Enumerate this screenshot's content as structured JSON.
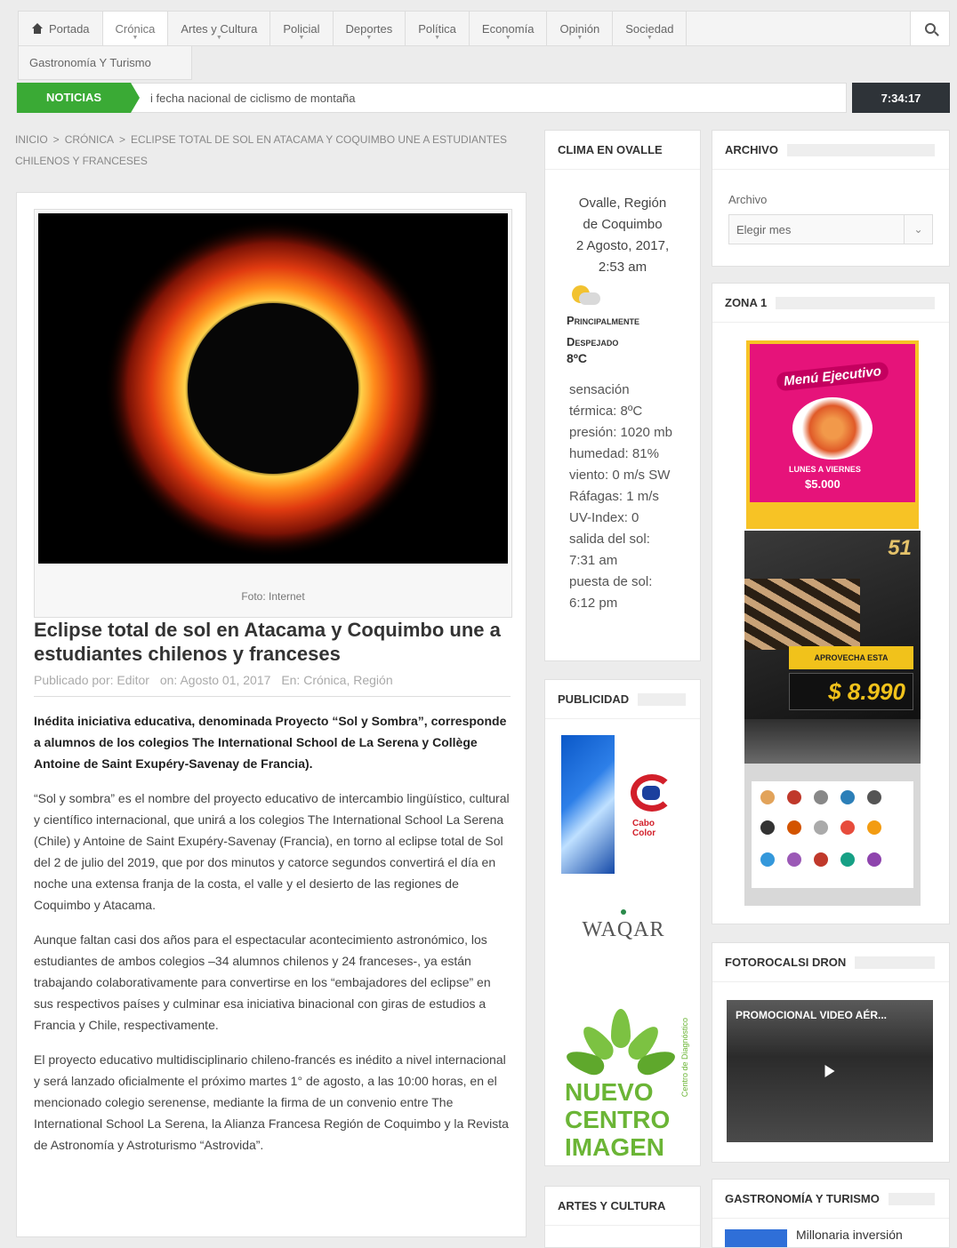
{
  "nav": {
    "items": [
      {
        "label": "Portada",
        "icon": "home-icon"
      },
      {
        "label": "Crónica"
      },
      {
        "label": "Artes y Cultura"
      },
      {
        "label": "Policial"
      },
      {
        "label": "Deportes"
      },
      {
        "label": "Política"
      },
      {
        "label": "Economía"
      },
      {
        "label": "Opinión"
      },
      {
        "label": "Sociedad"
      }
    ],
    "row2": "Gastronomía Y Turismo",
    "active": "Crónica"
  },
  "ticker": {
    "label": "NOTICIAS",
    "text": "i fecha nacional de ciclismo de montaña",
    "clock": "7:34:17"
  },
  "breadcrumb": [
    "INICIO",
    "CRÓNICA",
    "ECLIPSE TOTAL DE SOL EN ATACAMA Y COQUIMBO UNE A ESTUDIANTES CHILENOS Y FRANCESES"
  ],
  "article": {
    "caption": "Foto: Internet",
    "title": "Eclipse total de sol en Atacama y Coquimbo une a estudiantes chilenos y franceses",
    "meta": {
      "author": "Publicado por: Editor",
      "date": "on: Agosto 01, 2017",
      "category": "En: Crónica, Región"
    },
    "paragraphs": [
      "Inédita iniciativa educativa, denominada Proyecto “Sol y Sombra”, corresponde a alumnos de los colegios The International School de La Serena y Collège Antoine de Saint Exupéry-Savenay de Francia).",
      "“Sol y sombra” es el nombre del proyecto educativo de intercambio lingüístico, cultural y científico internacional, que unirá a los colegios The International School La Serena (Chile) y Antoine de Saint Exupéry-Savenay (Francia), en torno al eclipse total de Sol del 2 de julio del 2019, que por dos minutos y catorce segundos convertirá el día en noche una extensa franja de la costa, el valle y el desierto de las regiones de Coquimbo y Atacama.",
      "Aunque faltan casi dos años para el espectacular acontecimiento astronómico, los estudiantes de ambos colegios –34 alumnos chilenos y 24 franceses-, ya están trabajando colaborativamente para convertirse en los “embajadores del eclipse” en sus respectivos países y culminar esa iniciativa binacional  con giras de estudios a Francia y Chile, respectivamente.",
      "El proyecto educativo multidisciplinario chileno-francés es inédito a nivel internacional y será lanzado oficialmente el próximo martes 1° de agosto, a las 10:00 horas, en el mencionado colegio serenense, mediante la firma de un convenio entre The  International School La Serena, la Alianza Francesa Región de Coquimbo y la Revista de Astronomía y Astroturismo “Astrovida”."
    ]
  },
  "weather": {
    "title": "CLIMA EN OVALLE",
    "location": [
      "Ovalle, Región",
      "de Coquimbo",
      "2 Agosto, 2017,",
      "2:53 am"
    ],
    "description": "Principalmente Despejado",
    "temp": "8ºC",
    "details": [
      "sensación",
      "térmica: 8ºC",
      "presión: 1020 mb",
      "humedad: 81%",
      "viento: 0 m/s SW",
      "Ráfagas: 1 m/s",
      "UV-Index: 0",
      "salida del sol:",
      "7:31 am",
      "puesta de sol:",
      "6:12 pm"
    ]
  },
  "publicidad": {
    "title": "PUBLICIDAD",
    "ads": [
      "Cabo Color",
      "WAQAR",
      "NUEVO CENTRO IMAGEN",
      "Centro de Diagnóstico"
    ]
  },
  "artes": {
    "title": "ARTES Y CULTURA"
  },
  "archivo": {
    "title": "ARCHIVO",
    "label": "Archivo",
    "select": "Elegir mes"
  },
  "zona": {
    "title": "ZONA 1",
    "ad1": {
      "headline": "Menú Ejecutivo",
      "days": "LUNES A VIERNES",
      "price": "$5.000"
    },
    "ad2": {
      "badge": "51",
      "promo": "APROVECHA ESTA PROMOCIÓN",
      "price": "$ 8.990"
    }
  },
  "dron": {
    "title": "FOTOROCALSI DRON",
    "video_title": "PROMOCIONAL VIDEO AÉR..."
  },
  "gastro": {
    "title": "GASTRONOMÍA Y TURISMO",
    "item": "Millonaria inversión"
  }
}
